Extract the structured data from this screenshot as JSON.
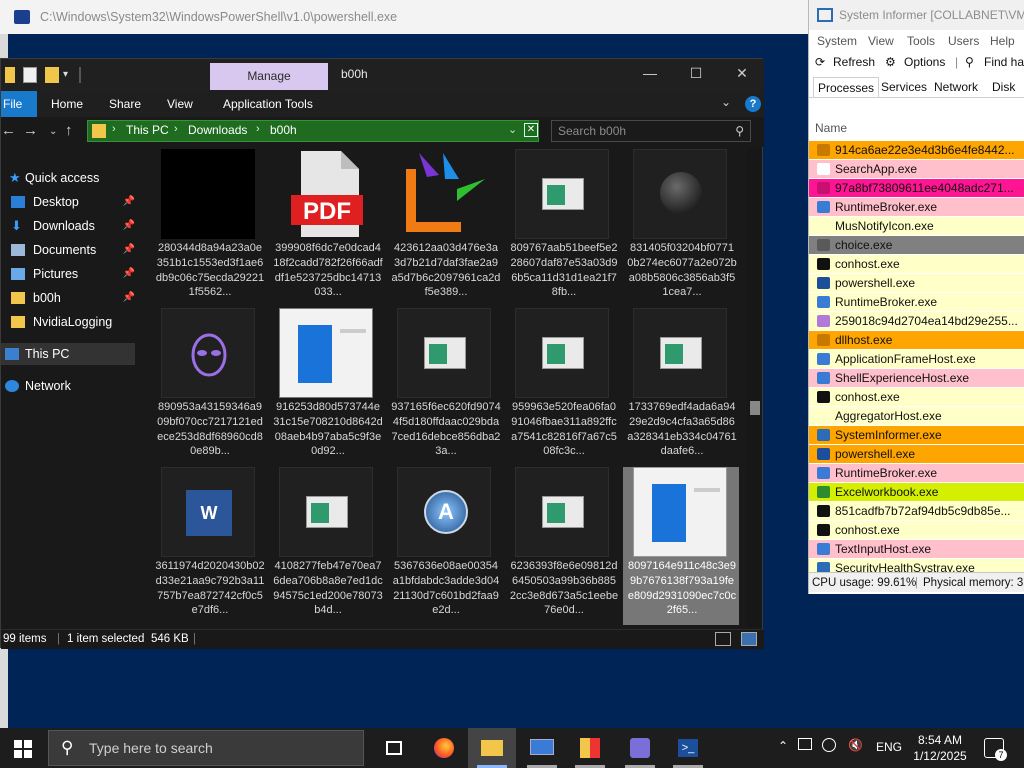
{
  "powershell": {
    "title": "C:\\Windows\\System32\\WindowsPowerShell\\v1.0\\powershell.exe"
  },
  "explorer": {
    "manage_label": "Manage",
    "folder_title": "b00h",
    "window_controls": {
      "minimize": "—",
      "maximize": "☐",
      "close": "✕"
    },
    "ribbon": {
      "file": "File",
      "home": "Home",
      "share": "Share",
      "view": "View",
      "app_tools": "Application Tools",
      "help": "?"
    },
    "address": {
      "parts": [
        "This PC",
        "Downloads",
        "b00h"
      ],
      "separator": "›"
    },
    "search_placeholder": "Search b00h",
    "nav": [
      {
        "label": "Quick access"
      },
      {
        "label": "Desktop"
      },
      {
        "label": "Downloads"
      },
      {
        "label": "Documents"
      },
      {
        "label": "Pictures"
      },
      {
        "label": "b00h"
      },
      {
        "label": "NvidiaLogging"
      },
      {
        "label": "This PC"
      },
      {
        "label": "Network"
      }
    ],
    "files": [
      {
        "name": "280344d8a94a23a0e351b1c1553ed3f1ae6db9c06c75ecda292211f5562..."
      },
      {
        "name": "399908f6dc7e0dcad418f2cadd782f26f66adfdf1e523725dbc14713033..."
      },
      {
        "name": "423612aa03d476e3a3d7b21d7daf3fae2a9a5d7b6c2097961ca2df5e389..."
      },
      {
        "name": "809767aab51beef5e228607daf87e53a03d96b5ca11d31d1ea21f78fb..."
      },
      {
        "name": "831405f03204bf07710b274ec6077a2e072ba08b5806c3856ab3f51cea7..."
      },
      {
        "name": "890953a43159346a909bf070cc7217121edece253d8df68960cd80e89b..."
      },
      {
        "name": "916253d80d573744e31c15e708210d8642d08aeb4b97aba5c9f3e0d92..."
      },
      {
        "name": "937165f6ec620fd90744f5d180ffdaac029bda7ced16debce856dba23a..."
      },
      {
        "name": "959963e520fea06fa091046fbae311a892ffca7541c82816f7a67c508fc3c..."
      },
      {
        "name": "1733769edf4ada6a9429e2d9c4cfa3a65d86a328341eb334c04761daafe6..."
      },
      {
        "name": "3611974d2020430b02d33e21aa9c792b3a11757b7ea872742cf0c5e7df6..."
      },
      {
        "name": "4108277feb47e70ea76dea706b8a8e7ed1dc94575c1ed200e78073b4d..."
      },
      {
        "name": "5367636e08ae00354a1bfdabdc3adde3d0421130d7c601bd2faa9e2d..."
      },
      {
        "name": "6236393f8e6e09812d6450503a99b36b8852cc3e8d673a5c1eebe76e0d..."
      },
      {
        "name": "8097164e911c48c3e99b7676138f793a19fee809d2931090ec7c0c2f65..."
      }
    ],
    "status": {
      "items": "99 items",
      "selected": "1 item selected",
      "size": "546 KB"
    }
  },
  "system_informer": {
    "title": "System Informer [COLLABNET\\VM9]",
    "menu": [
      "System",
      "View",
      "Tools",
      "Users",
      "Help"
    ],
    "toolbar": {
      "refresh": "Refresh",
      "options": "Options",
      "find": "Find ha"
    },
    "tabs": [
      "Processes",
      "Services",
      "Network",
      "Disk"
    ],
    "column": "Name",
    "processes": [
      {
        "name": "914ca6ae22e3e4d3b6e4fe8442...",
        "bg": "#ffa500",
        "icon": "#c87a00"
      },
      {
        "name": "SearchApp.exe",
        "bg": "#ffc0cb",
        "icon": "#ffffff"
      },
      {
        "name": "97a8bf73809611ee4048adc271...",
        "bg": "#ff1493",
        "icon": "#c81070"
      },
      {
        "name": "RuntimeBroker.exe",
        "bg": "#ffc0cb",
        "icon": "#3a7bd5"
      },
      {
        "name": "MusNotifyIcon.exe",
        "bg": "#ffffc8",
        "icon": "#ffffc8"
      },
      {
        "name": "choice.exe",
        "bg": "#808080",
        "icon": "#5a5a5a"
      },
      {
        "name": "conhost.exe",
        "bg": "#ffffc8",
        "icon": "#111111"
      },
      {
        "name": "powershell.exe",
        "bg": "#ffffc8",
        "icon": "#1b4f9c"
      },
      {
        "name": "RuntimeBroker.exe",
        "bg": "#ffffc8",
        "icon": "#3a7bd5"
      },
      {
        "name": "259018c94d2704ea14bd29e255...",
        "bg": "#ffffc8",
        "icon": "#b07ad8"
      },
      {
        "name": "dllhost.exe",
        "bg": "#ffa500",
        "icon": "#c87a00"
      },
      {
        "name": "ApplicationFrameHost.exe",
        "bg": "#ffffc8",
        "icon": "#3a7bd5"
      },
      {
        "name": "ShellExperienceHost.exe",
        "bg": "#ffc0cb",
        "icon": "#3a7bd5"
      },
      {
        "name": "conhost.exe",
        "bg": "#ffffc8",
        "icon": "#111111"
      },
      {
        "name": "AggregatorHost.exe",
        "bg": "#ffffc8",
        "icon": "#ffffc8"
      },
      {
        "name": "SystemInformer.exe",
        "bg": "#ffa500",
        "icon": "#2c6bb5"
      },
      {
        "name": "powershell.exe",
        "bg": "#ffa500",
        "icon": "#1b4f9c"
      },
      {
        "name": "RuntimeBroker.exe",
        "bg": "#ffc0cb",
        "icon": "#3a7bd5"
      },
      {
        "name": "Excelworkbook.exe",
        "bg": "#d4f000",
        "icon": "#2e8b2e"
      },
      {
        "name": "851cadfb7b72af94db5c9db85e...",
        "bg": "#ffffc8",
        "icon": "#111111"
      },
      {
        "name": "conhost.exe",
        "bg": "#ffffc8",
        "icon": "#111111"
      },
      {
        "name": "TextInputHost.exe",
        "bg": "#ffc0cb",
        "icon": "#3a7bd5"
      },
      {
        "name": "SecurityHealthSystray.exe",
        "bg": "#ffffc8",
        "icon": "#2c6bb5"
      }
    ],
    "status": {
      "cpu": "CPU usage: 99.61%",
      "mem": "Physical memory: 3"
    }
  },
  "taskbar": {
    "search_placeholder": "Type here to search",
    "language": "ENG",
    "time": "8:54 AM",
    "date": "1/12/2025",
    "notification_count": "7"
  }
}
